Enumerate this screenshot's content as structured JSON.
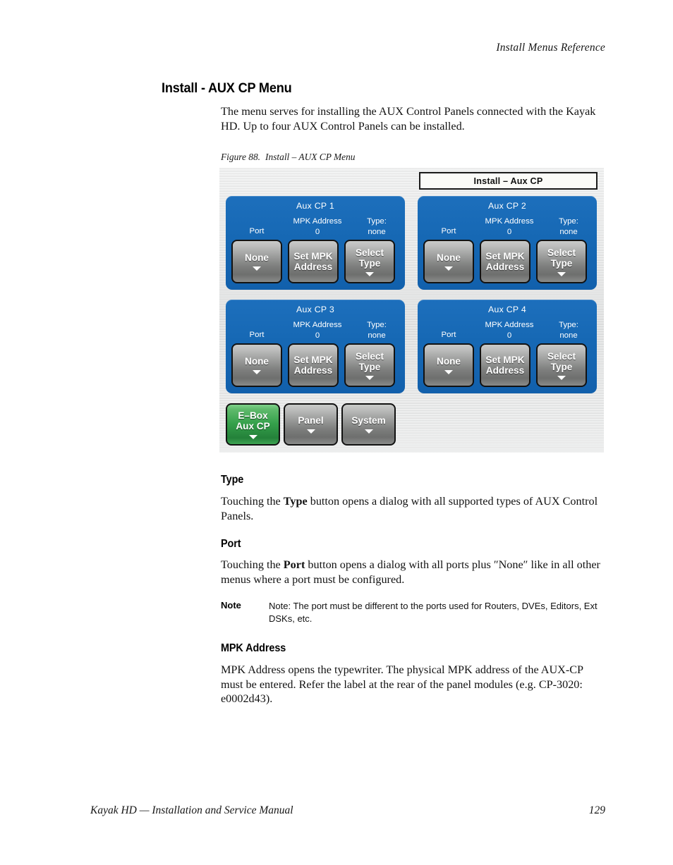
{
  "page": {
    "running_head": "Install Menus Reference",
    "heading": "Install - AUX CP Menu",
    "intro": "The menu serves for installing the AUX Control Panels connected with the Kayak HD. Up to four AUX Control Panels can be installed."
  },
  "figure": {
    "caption_number": "Figure 88.",
    "caption_text": "Install – AUX CP Menu",
    "titlebar": "Install – Aux CP",
    "colors": {
      "panel_blue": "#1668b4",
      "button_grey": "#8e8f8e",
      "button_green_active": "#35a04b",
      "background_metal": "#e6e7e7",
      "titlebar_background": "#fbfbf8"
    },
    "panels": [
      {
        "title": "Aux CP 1",
        "port_label": "Port",
        "mpk_label": "MPK Address",
        "mpk_value": "0",
        "type_label": "Type:",
        "type_value": "none",
        "port_button": "None",
        "mpk_button_line1": "Set MPK",
        "mpk_button_line2": "Address",
        "type_button_line1": "Select",
        "type_button_line2": "Type"
      },
      {
        "title": "Aux CP 2",
        "port_label": "Port",
        "mpk_label": "MPK Address",
        "mpk_value": "0",
        "type_label": "Type:",
        "type_value": "none",
        "port_button": "None",
        "mpk_button_line1": "Set MPK",
        "mpk_button_line2": "Address",
        "type_button_line1": "Select",
        "type_button_line2": "Type"
      },
      {
        "title": "Aux CP 3",
        "port_label": "Port",
        "mpk_label": "MPK Address",
        "mpk_value": "0",
        "type_label": "Type:",
        "type_value": "none",
        "port_button": "None",
        "mpk_button_line1": "Set MPK",
        "mpk_button_line2": "Address",
        "type_button_line1": "Select",
        "type_button_line2": "Type"
      },
      {
        "title": "Aux CP 4",
        "port_label": "Port",
        "mpk_label": "MPK Address",
        "mpk_value": "0",
        "type_label": "Type:",
        "type_value": "none",
        "port_button": "None",
        "mpk_button_line1": "Set MPK",
        "mpk_button_line2": "Address",
        "type_button_line1": "Select",
        "type_button_line2": "Type"
      }
    ],
    "nav": [
      {
        "line1": "E–Box",
        "line2": "Aux CP",
        "state": "selected"
      },
      {
        "line1": "Panel",
        "line2": "",
        "state": "normal"
      },
      {
        "line1": "System",
        "line2": "",
        "state": "normal"
      }
    ]
  },
  "sections": [
    {
      "heading": "Type",
      "body_before": "Touching the ",
      "body_bold": "Type",
      "body_after": " button opens a dialog with all supported types of AUX Control Panels."
    },
    {
      "heading": "Port",
      "body_before": "Touching the ",
      "body_bold": "Port",
      "body_after": " button opens a dialog with all ports plus ″None″ like in all other menus where a port must be configured."
    }
  ],
  "note": {
    "label": "Note",
    "text": "Note: The port must be different to the ports used for Routers, DVEs, Editors, Ext DSKs, etc."
  },
  "mpk_section": {
    "heading": "MPK Address",
    "body": "MPK Address opens the typewriter. The physical MPK address of the AUX-CP must be entered. Refer the label at the rear of the panel modules (e.g. CP-3020: e0002d43)."
  },
  "footer": {
    "left": "Kayak HD  —  Installation and Service Manual",
    "page_number": "129"
  }
}
